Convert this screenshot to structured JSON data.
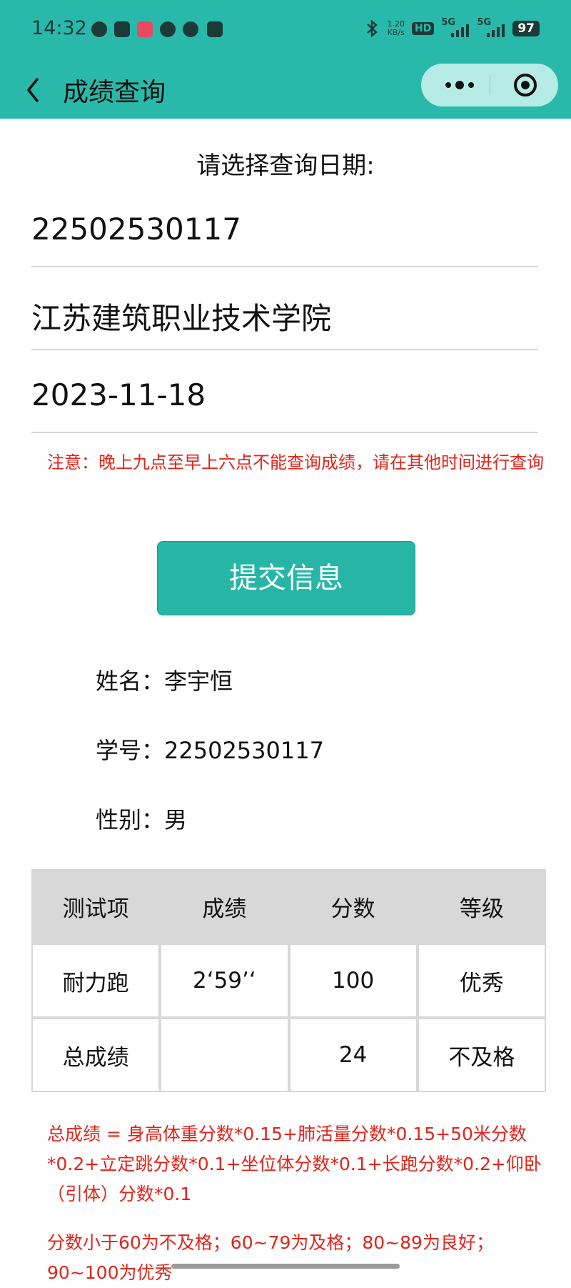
{
  "status_bar": {
    "time": "14:32",
    "network_speed": "1.20",
    "network_unit": "KB/s",
    "hd_label": "HD",
    "sim1_label": "5G",
    "sim2_label": "5G",
    "battery": "97"
  },
  "navbar": {
    "title": "成绩查询"
  },
  "form": {
    "prompt": "请选择查询日期:",
    "student_id": "22502530117",
    "school": "江苏建筑职业技术学院",
    "date": "2023-11-18",
    "notice": "注意：晚上九点至早上六点不能查询成绩，请在其他时间进行查询",
    "submit_label": "提交信息"
  },
  "student": {
    "name_line": "姓名：李宇恒",
    "id_line": "学号：22502530117",
    "gender_line": "性别：男"
  },
  "table": {
    "headers": [
      "测试项",
      "成绩",
      "分数",
      "等级"
    ],
    "rows": [
      [
        "耐力跑",
        "2‘59’‘",
        "100",
        "优秀"
      ],
      [
        "总成绩",
        "",
        "24",
        "不及格"
      ]
    ]
  },
  "formula_text": "总成绩 = 身高体重分数*0.15+肺活量分数*0.15+50米分数*0.2+立定跳分数*0.1+坐位体分数*0.1+长跑分数*0.2+仰卧（引体）分数*0.1",
  "grade_text": "分数小于60为不及格；60~79为及格；80~89为良好；90~100为优秀",
  "colors": {
    "header_bg": "#29b9aa",
    "button_bg": "#27b6a6",
    "warning_text": "#e1251b",
    "table_header_bg": "#d8d8d8"
  }
}
